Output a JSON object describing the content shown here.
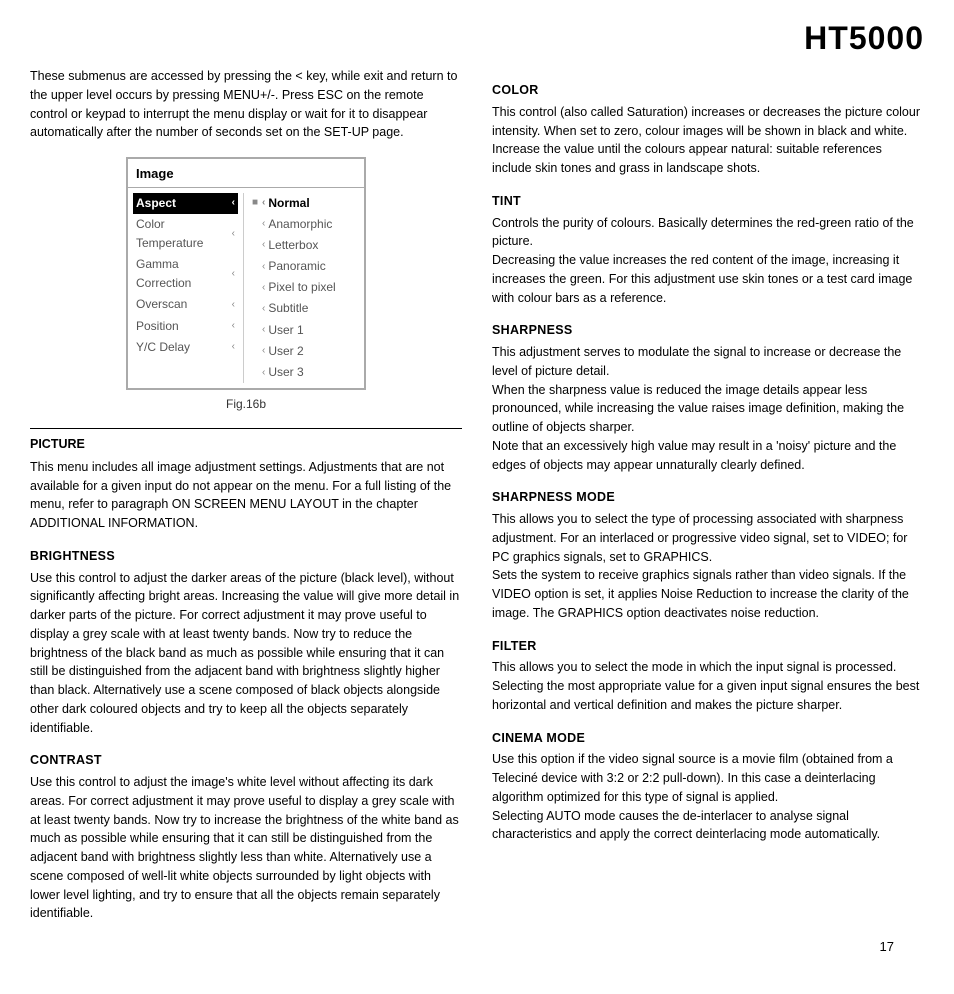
{
  "header": {
    "title": "HT5000"
  },
  "intro": "These submenus are accessed by pressing the < key, while exit and return to the upper level occurs by pressing MENU+/-. Press ESC on the remote control or keypad to interrupt the menu display or wait for it to disappear automatically after the number of seconds set on the SET-UP page.",
  "menu": {
    "title": "Image",
    "left_items": [
      {
        "label": "Aspect",
        "selected": true
      },
      {
        "label": "Color Temperature"
      },
      {
        "label": "Gamma Correction"
      },
      {
        "label": "Overscan"
      },
      {
        "label": "Position"
      },
      {
        "label": "Y/C Delay"
      }
    ],
    "right_items": [
      {
        "label": "Normal",
        "selected": true,
        "bullet": "■"
      },
      {
        "label": "Anamorphic",
        "bullet": "◁"
      },
      {
        "label": "Letterbox",
        "bullet": "◁"
      },
      {
        "label": "Panoramic",
        "bullet": "◁"
      },
      {
        "label": "Pixel to pixel",
        "bullet": "◁"
      },
      {
        "label": "Subtitle",
        "bullet": "◁"
      },
      {
        "label": "User 1",
        "bullet": "◁"
      },
      {
        "label": "User 2",
        "bullet": "◁"
      },
      {
        "label": "User 3",
        "bullet": "◁"
      }
    ]
  },
  "fig_caption": "Fig.16b",
  "left_col": {
    "picture_heading": "PICTURE",
    "picture_intro": "This menu includes all image adjustment settings. Adjustments that are not available for a given input do not appear on the menu. For a full listing of the menu, refer to paragraph ON SCREEN MENU LAYOUT in the chapter ADDITIONAL INFORMATION.",
    "sections": [
      {
        "heading": "BRIGHTNESS",
        "text": "Use this control to adjust the darker areas of the picture (black level), without significantly affecting bright areas. Increasing the value will give more detail in darker parts of the picture. For correct adjustment it may prove useful to display a grey scale with at least twenty bands. Now try to reduce the brightness of the black band as much as possible while ensuring that it can still be distinguished from the adjacent band with brightness slightly higher than black. Alternatively use a scene composed of black objects alongside other dark coloured objects and try to keep all the objects separately identifiable."
      },
      {
        "heading": "CONTRAST",
        "text": "Use this control to adjust the image's white level without affecting its dark areas. For correct adjustment it may prove useful to display a grey scale with at least twenty bands. Now try to increase the brightness of the white band as much as possible while ensuring that it can still be distinguished from the adjacent band with brightness slightly less than white. Alternatively use a scene composed of well-lit white objects surrounded by light objects with lower level lighting, and try to ensure that all the objects remain separately identifiable."
      }
    ]
  },
  "right_col": {
    "sections": [
      {
        "heading": "COLOR",
        "text": "This control (also called Saturation) increases or decreases the picture colour intensity. When set to zero, colour images will be shown in black and white. Increase the value until the colours appear natural: suitable references include skin tones and grass in landscape shots."
      },
      {
        "heading": "TINT",
        "text": "Controls the purity of colours. Basically determines the red-green ratio of the picture.\nDecreasing the value increases the red content of the image, increasing it increases the green. For this adjustment use skin tones or a test card image with colour bars as a reference."
      },
      {
        "heading": "SHARPNESS",
        "text": "This adjustment serves to modulate the signal to increase or decrease the level of picture detail.\nWhen the sharpness value is reduced the image details appear less pronounced, while increasing the value raises image definition, making the outline of objects sharper.\nNote that an excessively high value may result in a 'noisy' picture and the edges of objects may appear unnaturally clearly defined."
      },
      {
        "heading": "SHARPNESS MODE",
        "text": "This allows you to select the type of processing associated with sharpness adjustment. For an interlaced or progressive video signal, set to VIDEO; for PC graphics signals, set to GRAPHICS.\nSets the system to receive graphics signals rather than video signals. If the VIDEO option is set, it applies Noise Reduction to increase the clarity of the image. The GRAPHICS option deactivates noise reduction."
      },
      {
        "heading": "FILTER",
        "text": "This allows you to select the mode in which the input signal is processed. Selecting the most appropriate value for a given input signal ensures the best horizontal and vertical definition and makes the picture sharper."
      },
      {
        "heading": "CINEMA MODE",
        "text": "Use this option if the video signal source is a movie film (obtained from a Teleciné device with 3:2 or 2:2 pull-down). In this case a deinterlacing algorithm optimized for this type of signal is applied.\nSelecting AUTO mode causes the de-interlacer to analyse signal characteristics and apply the correct deinterlacing mode automatically."
      }
    ]
  },
  "page_number": "17"
}
